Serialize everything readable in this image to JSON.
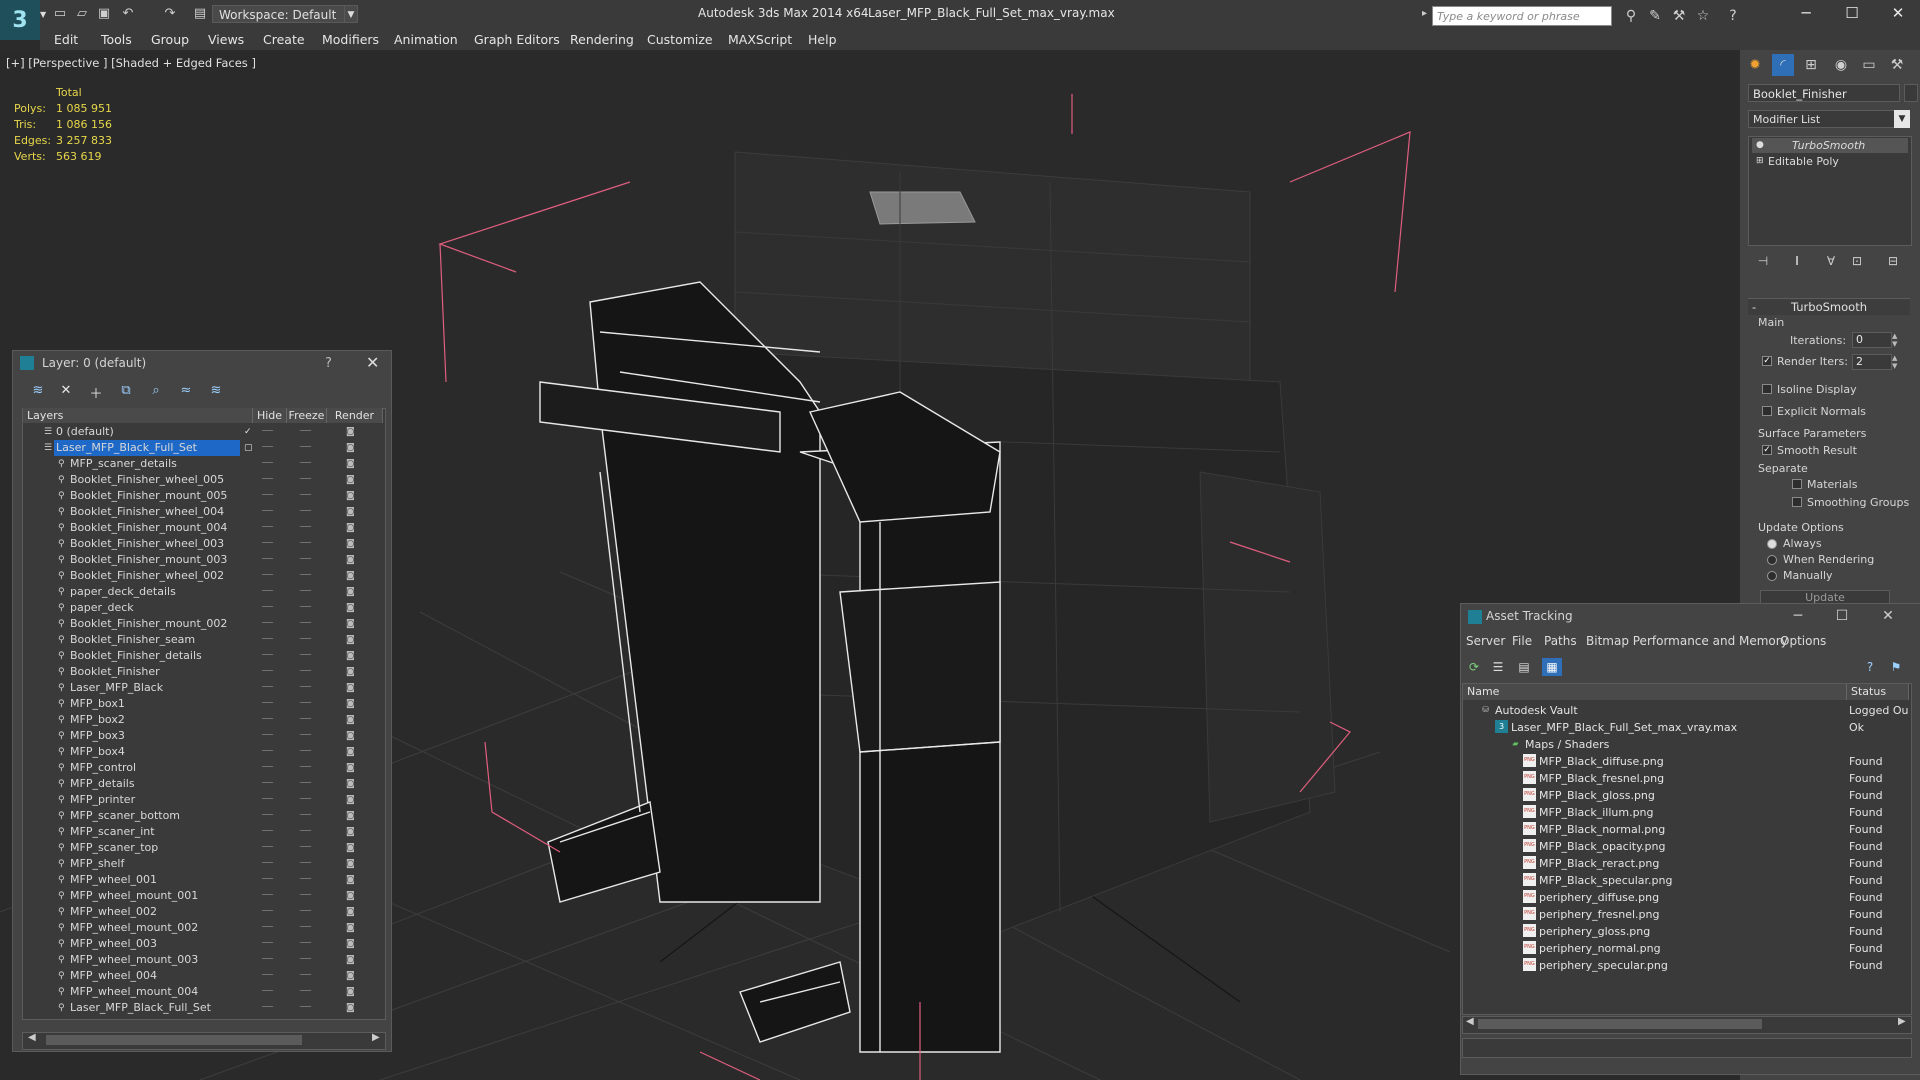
{
  "titlebar": {
    "workspace": "Workspace: Default",
    "app_title": "Autodesk 3ds Max  2014 x64",
    "file_title": "Laser_MFP_Black_Full_Set_max_vray.max",
    "search_placeholder": "Type a keyword or phrase"
  },
  "menu": [
    "Edit",
    "Tools",
    "Group",
    "Views",
    "Create",
    "Modifiers",
    "Animation",
    "Graph Editors",
    "Rendering",
    "Customize",
    "MAXScript",
    "Help"
  ],
  "viewport": {
    "label": "[+] [Perspective ] [Shaded + Edged Faces ]",
    "stats": {
      "header": "Total",
      "polys_label": "Polys:",
      "polys": "1 085 951",
      "tris_label": "Tris:",
      "tris": "1 086 156",
      "edges_label": "Edges:",
      "edges": "3 257 833",
      "verts_label": "Verts:",
      "verts": "563 619"
    },
    "colors": {
      "stats": "#e7d74a",
      "bbox": "#e05e7e",
      "grid": "#3a3a3a"
    }
  },
  "layer_explorer": {
    "title": "Layer: 0 (default)",
    "help": "?",
    "columns": {
      "layers": "Layers",
      "hide": "Hide",
      "freeze": "Freeze",
      "render": "Render"
    },
    "rows": [
      {
        "name": "0 (default)",
        "level": 0
      },
      {
        "name": "Laser_MFP_Black_Full_Set",
        "level": 0,
        "selected": true
      },
      {
        "name": "MFP_scaner_details",
        "level": 1
      },
      {
        "name": "Booklet_Finisher_wheel_005",
        "level": 1
      },
      {
        "name": "Booklet_Finisher_mount_005",
        "level": 1
      },
      {
        "name": "Booklet_Finisher_wheel_004",
        "level": 1
      },
      {
        "name": "Booklet_Finisher_mount_004",
        "level": 1
      },
      {
        "name": "Booklet_Finisher_wheel_003",
        "level": 1
      },
      {
        "name": "Booklet_Finisher_mount_003",
        "level": 1
      },
      {
        "name": "Booklet_Finisher_wheel_002",
        "level": 1
      },
      {
        "name": "paper_deck_details",
        "level": 1
      },
      {
        "name": "paper_deck",
        "level": 1
      },
      {
        "name": "Booklet_Finisher_mount_002",
        "level": 1
      },
      {
        "name": "Booklet_Finisher_seam",
        "level": 1
      },
      {
        "name": "Booklet_Finisher_details",
        "level": 1
      },
      {
        "name": "Booklet_Finisher",
        "level": 1
      },
      {
        "name": "Laser_MFP_Black",
        "level": 1
      },
      {
        "name": "MFP_box1",
        "level": 1
      },
      {
        "name": "MFP_box2",
        "level": 1
      },
      {
        "name": "MFP_box3",
        "level": 1
      },
      {
        "name": "MFP_box4",
        "level": 1
      },
      {
        "name": "MFP_control",
        "level": 1
      },
      {
        "name": "MFP_details",
        "level": 1
      },
      {
        "name": "MFP_printer",
        "level": 1
      },
      {
        "name": "MFP_scaner_bottom",
        "level": 1
      },
      {
        "name": "MFP_scaner_int",
        "level": 1
      },
      {
        "name": "MFP_scaner_top",
        "level": 1
      },
      {
        "name": "MFP_shelf",
        "level": 1
      },
      {
        "name": "MFP_wheel_001",
        "level": 1
      },
      {
        "name": "MFP_wheel_mount_001",
        "level": 1
      },
      {
        "name": "MFP_wheel_002",
        "level": 1
      },
      {
        "name": "MFP_wheel_mount_002",
        "level": 1
      },
      {
        "name": "MFP_wheel_003",
        "level": 1
      },
      {
        "name": "MFP_wheel_mount_003",
        "level": 1
      },
      {
        "name": "MFP_wheel_004",
        "level": 1
      },
      {
        "name": "MFP_wheel_mount_004",
        "level": 1
      },
      {
        "name": "Laser_MFP_Black_Full_Set",
        "level": 1
      }
    ],
    "colors": {
      "selection": "#1e68c8"
    }
  },
  "command_panel": {
    "object_name": "Booklet_Finisher",
    "modifier_list": "Modifier List",
    "stack": [
      "TurboSmooth",
      "Editable Poly"
    ],
    "turbosmooth": {
      "header": "TurboSmooth",
      "main": "Main",
      "iterations_label": "Iterations:",
      "iterations": "0",
      "render_iters_label": "Render Iters:",
      "render_iters": "2",
      "isoline": "Isoline Display",
      "explicit_normals": "Explicit Normals",
      "surface_params": "Surface Parameters",
      "smooth_result": "Smooth Result",
      "separate": "Separate",
      "materials": "Materials",
      "smoothing_groups": "Smoothing Groups",
      "update_options": "Update Options",
      "always": "Always",
      "when_rendering": "When Rendering",
      "manually": "Manually",
      "update_button": "Update"
    }
  },
  "asset_tracking": {
    "title": "Asset Tracking",
    "menu": [
      "Server",
      "File",
      "Paths",
      "Bitmap Performance and Memory",
      "Options"
    ],
    "columns": {
      "name": "Name",
      "status": "Status"
    },
    "rows": [
      {
        "name": "Autodesk Vault",
        "status": "Logged Ou",
        "level": 0,
        "icon": "vault"
      },
      {
        "name": "Laser_MFP_Black_Full_Set_max_vray.max",
        "status": "Ok",
        "level": 1,
        "icon": "max"
      },
      {
        "name": "Maps / Shaders",
        "status": "",
        "level": 2,
        "icon": "maps"
      },
      {
        "name": "MFP_Black_diffuse.png",
        "status": "Found",
        "level": 3,
        "icon": "png"
      },
      {
        "name": "MFP_Black_fresnel.png",
        "status": "Found",
        "level": 3,
        "icon": "png"
      },
      {
        "name": "MFP_Black_gloss.png",
        "status": "Found",
        "level": 3,
        "icon": "png"
      },
      {
        "name": "MFP_Black_illum.png",
        "status": "Found",
        "level": 3,
        "icon": "png"
      },
      {
        "name": "MFP_Black_normal.png",
        "status": "Found",
        "level": 3,
        "icon": "png"
      },
      {
        "name": "MFP_Black_opacity.png",
        "status": "Found",
        "level": 3,
        "icon": "png"
      },
      {
        "name": "MFP_Black_reract.png",
        "status": "Found",
        "level": 3,
        "icon": "png"
      },
      {
        "name": "MFP_Black_specular.png",
        "status": "Found",
        "level": 3,
        "icon": "png"
      },
      {
        "name": "periphery_diffuse.png",
        "status": "Found",
        "level": 3,
        "icon": "png"
      },
      {
        "name": "periphery_fresnel.png",
        "status": "Found",
        "level": 3,
        "icon": "png"
      },
      {
        "name": "periphery_gloss.png",
        "status": "Found",
        "level": 3,
        "icon": "png"
      },
      {
        "name": "periphery_normal.png",
        "status": "Found",
        "level": 3,
        "icon": "png"
      },
      {
        "name": "periphery_specular.png",
        "status": "Found",
        "level": 3,
        "icon": "png"
      }
    ]
  }
}
